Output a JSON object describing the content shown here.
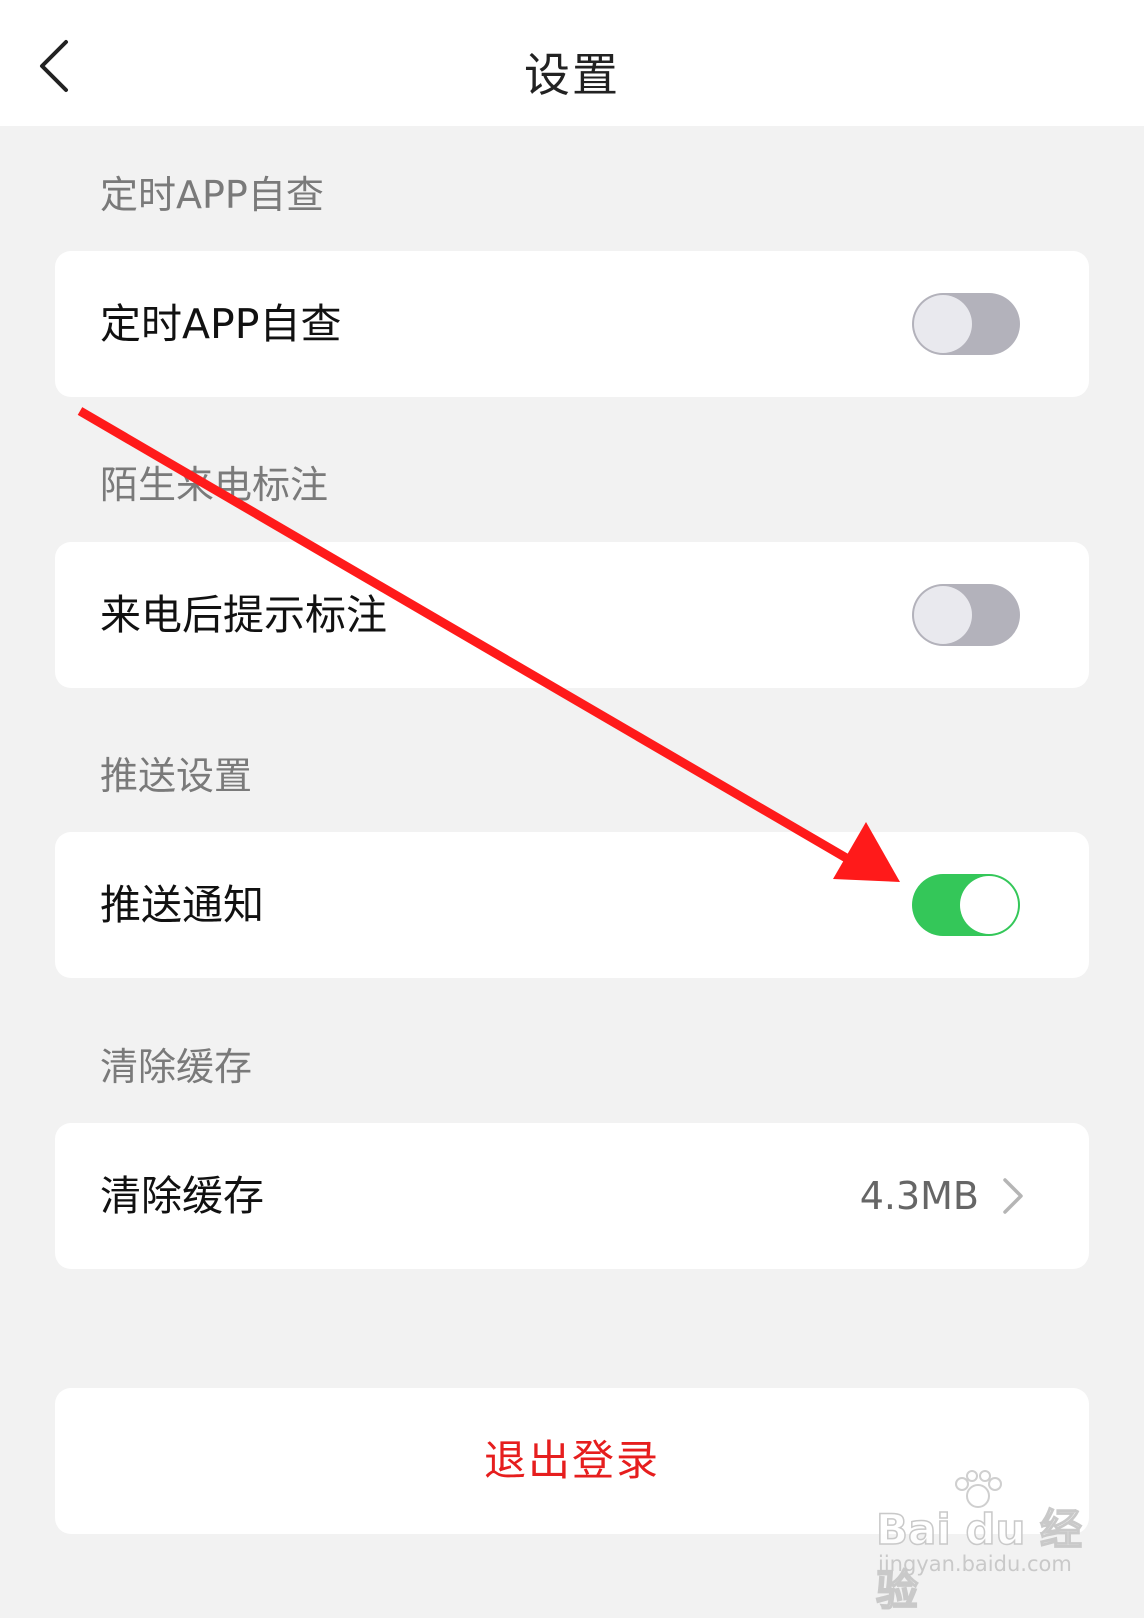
{
  "header": {
    "title": "设置",
    "back_icon": "chevron-left-icon"
  },
  "sections": [
    {
      "label": "定时APP自查",
      "row_label": "定时APP自查",
      "toggle_on": false
    },
    {
      "label": "陌生来电标注",
      "row_label": "来电后提示标注",
      "toggle_on": false
    },
    {
      "label": "推送设置",
      "row_label": "推送通知",
      "toggle_on": true
    },
    {
      "label": "清除缓存",
      "row_label": "清除缓存",
      "value": "4.3MB",
      "chevron_icon": "chevron-right-icon"
    }
  ],
  "logout": {
    "label": "退出登录"
  },
  "annotation": {
    "color": "#ff1a1a",
    "icon": "red-arrow-annotation"
  },
  "watermark": {
    "brand": "Bai du 经验",
    "url": "jingyan.baidu.com"
  },
  "colors": {
    "toggle_on": "#34c759",
    "toggle_off": "#b3b2bb",
    "logout_text": "#e61e1e",
    "background": "#f2f2f2"
  }
}
